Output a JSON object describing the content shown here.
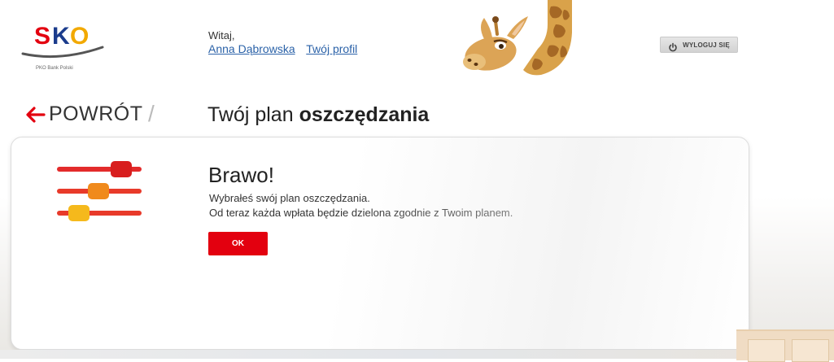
{
  "header": {
    "logo_text": "SKO",
    "logo_subtitle": "PKO Bank Polski",
    "greeting": "Witaj,",
    "user_name": "Anna Dąbrowska",
    "profile_link": "Twój profil",
    "logout_label": "WYLOGUJ SIĘ",
    "mascot": "giraffe"
  },
  "breadcrumb": {
    "back_label": "POWRÓT",
    "separator": "/",
    "title_regular": "Twój plan ",
    "title_bold": "oszczędzania"
  },
  "card": {
    "heading": "Brawo!",
    "line1": "Wybrałeś swój plan oszczędzania.",
    "line2": "Od teraz każda wpłata będzie dzielona zgodnie z Twoim planem.",
    "ok_label": "OK",
    "icon": "sliders-icon"
  },
  "colors": {
    "brand_red": "#e3000f",
    "link_blue": "#2b62a8",
    "slider_red": "#e32b2b",
    "slider_orange": "#f08a1c",
    "slider_yellow": "#f5b91c"
  }
}
